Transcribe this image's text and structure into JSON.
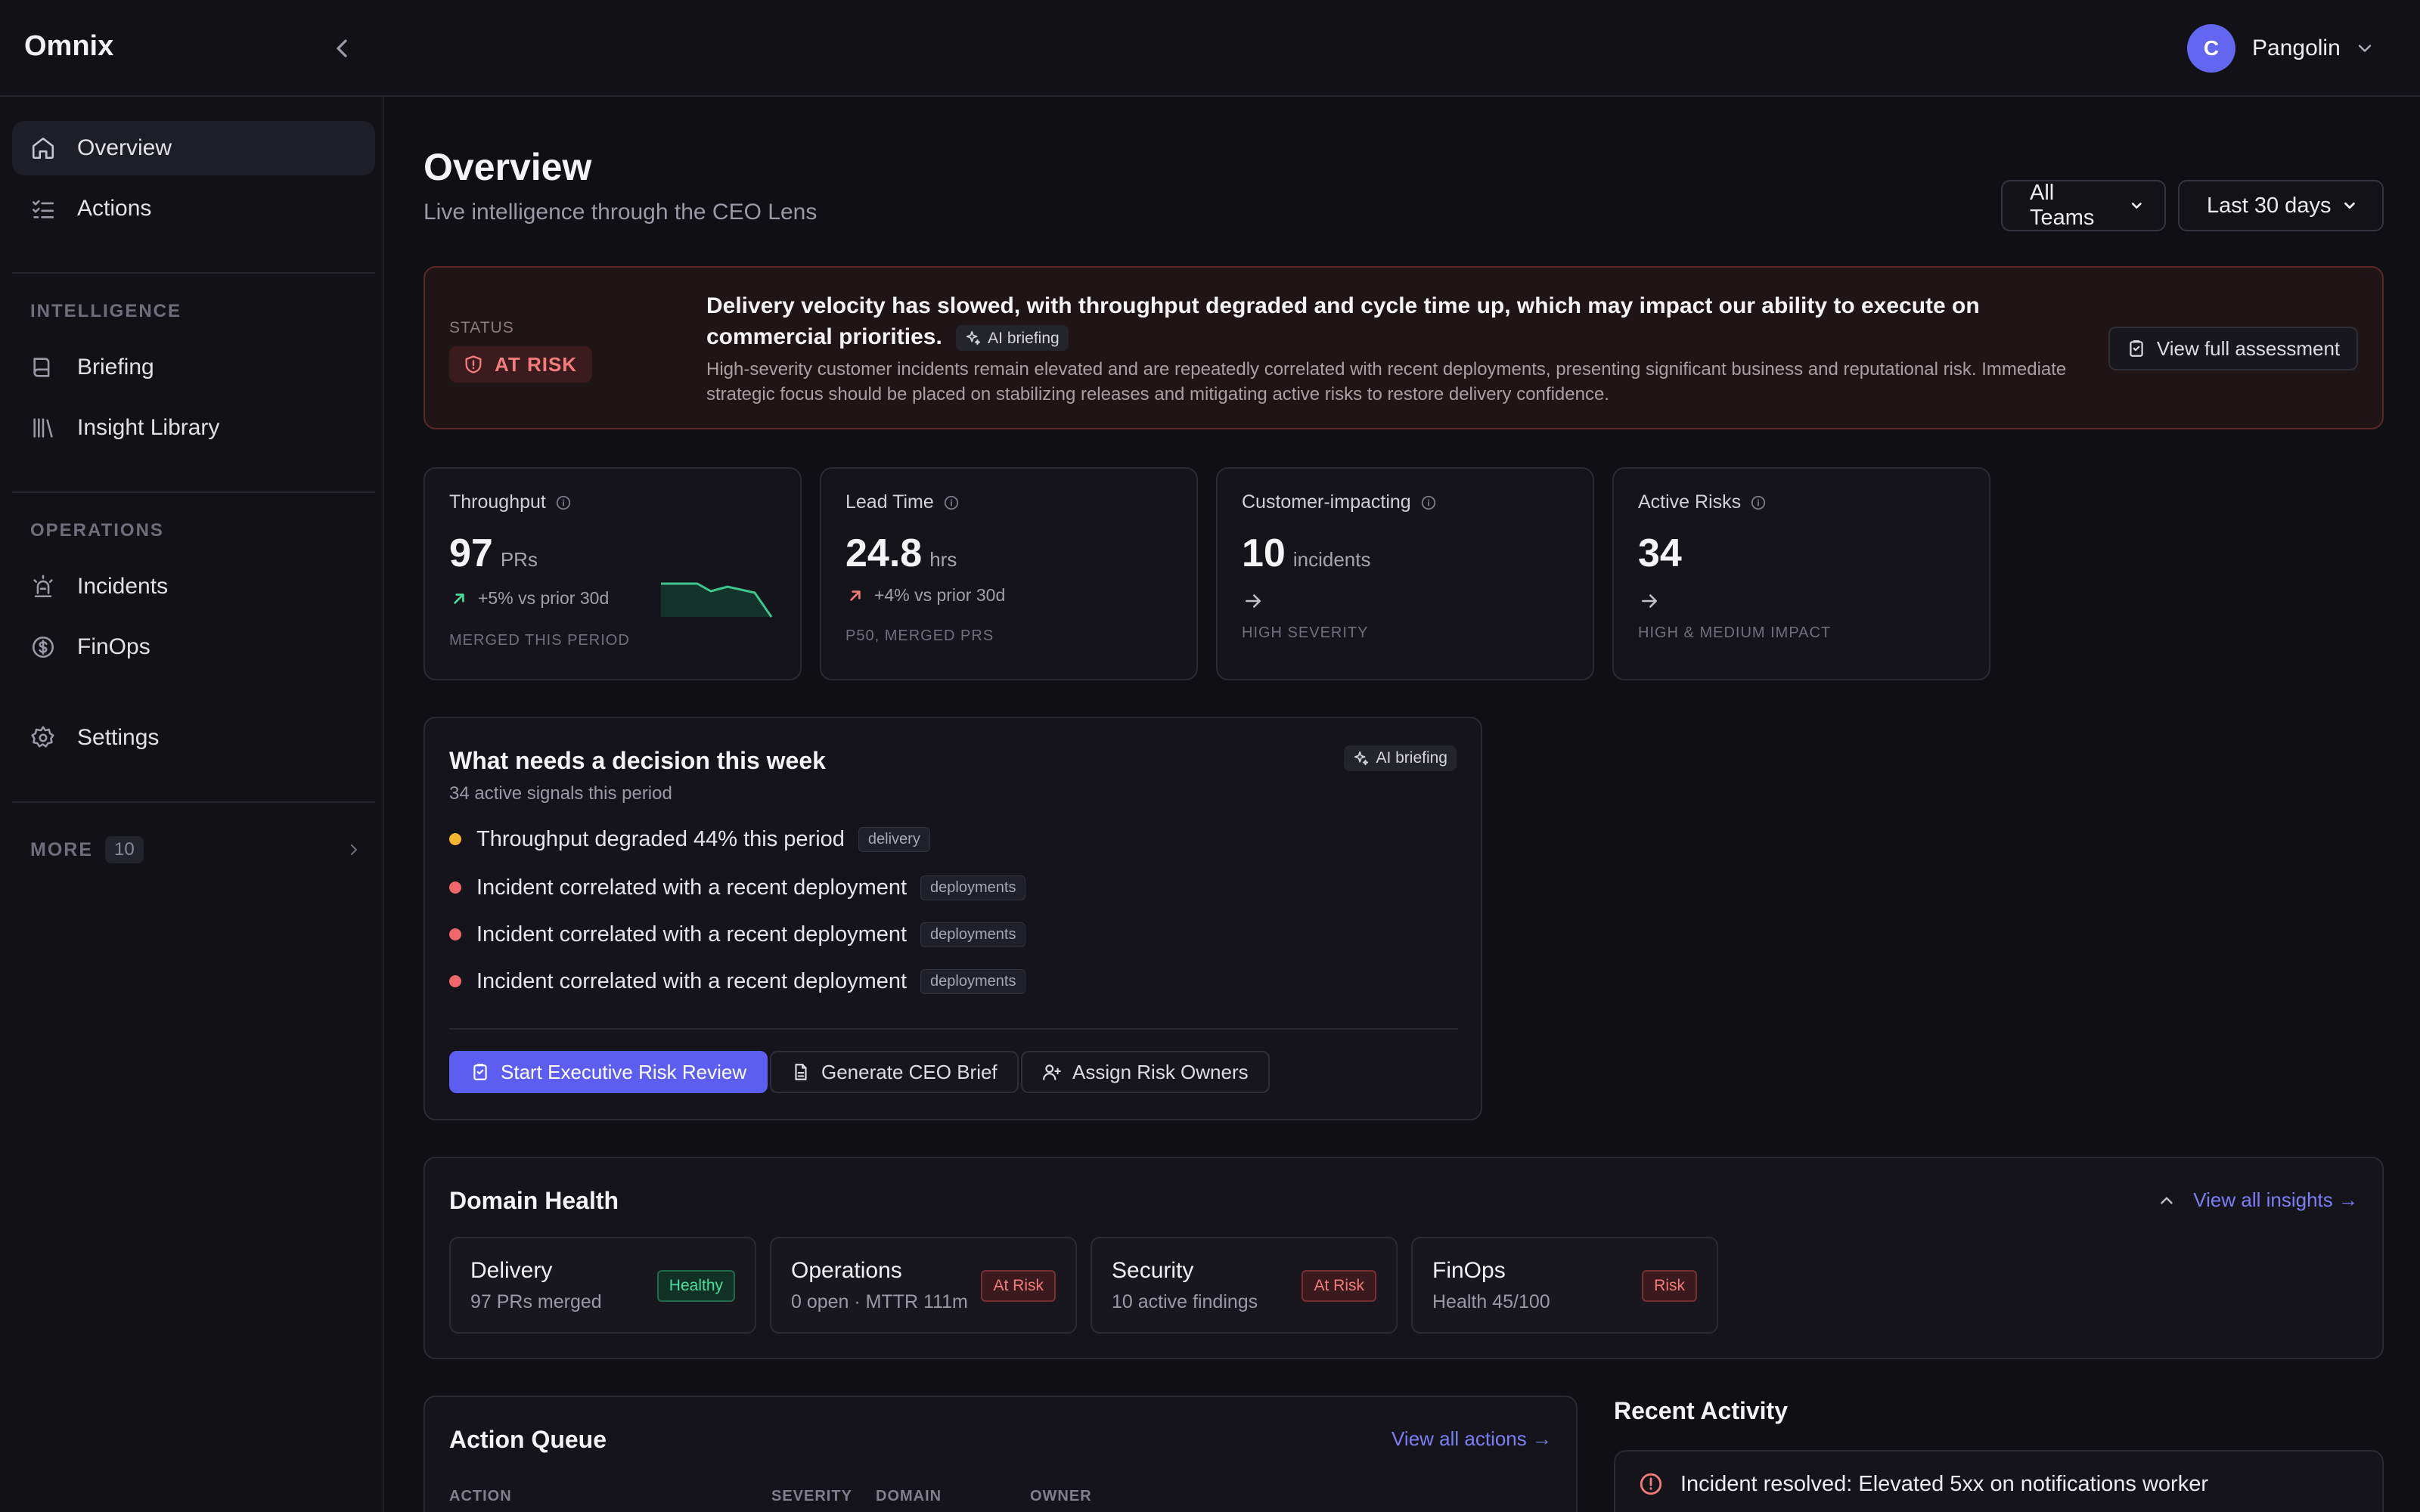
{
  "app": {
    "name": "Omnix"
  },
  "user": {
    "initial": "C",
    "name": "Pangolin"
  },
  "sidebar": {
    "items": [
      {
        "label": "Overview"
      },
      {
        "label": "Actions"
      },
      {
        "label": "Briefing"
      },
      {
        "label": "Insight Library"
      },
      {
        "label": "Incidents"
      },
      {
        "label": "FinOps"
      },
      {
        "label": "Settings"
      }
    ],
    "sections": {
      "intelligence": "INTELLIGENCE",
      "operations": "OPERATIONS"
    },
    "more": {
      "label": "MORE",
      "count": "10"
    }
  },
  "header": {
    "title": "Overview",
    "subtitle": "Live intelligence through the CEO Lens",
    "team_filter": "All Teams",
    "period_filter": "Last 30 days"
  },
  "status": {
    "label": "STATUS",
    "badge": "AT RISK",
    "headline": "Delivery velocity has slowed, with throughput degraded and cycle time up, which may impact our ability to execute on commercial priorities.",
    "ai_chip": "AI briefing",
    "body": "High-severity customer incidents remain elevated and are repeatedly correlated with recent deployments, presenting significant business and reputational risk. Immediate strategic focus should be placed on stabilizing releases and mitigating active risks to restore delivery confidence.",
    "button": "View full assessment",
    "color": "#f47b7b"
  },
  "kpis": [
    {
      "title": "Throughput",
      "value": "97",
      "unit": "PRs",
      "trend": "+5% vs prior 30d",
      "footer": "MERGED THIS PERIOD"
    },
    {
      "title": "Lead Time",
      "value": "24.8",
      "unit": "hrs",
      "trend": "+4% vs prior 30d",
      "footer": "P50, MERGED PRS"
    },
    {
      "title": "Customer-impacting",
      "value": "10",
      "unit": "incidents",
      "footer": "HIGH SEVERITY"
    },
    {
      "title": "Active Risks",
      "value": "34",
      "unit": "",
      "footer": "HIGH & MEDIUM IMPACT"
    }
  ],
  "decision": {
    "title": "What needs a decision this week",
    "subtitle": "34 active signals this period",
    "ai_chip": "AI briefing",
    "signals": [
      {
        "text": "Throughput degraded 44% this period",
        "tag": "delivery",
        "color": "#f5b52e"
      },
      {
        "text": "Incident correlated with a recent deployment",
        "tag": "deployments",
        "color": "#f0676a"
      },
      {
        "text": "Incident correlated with a recent deployment",
        "tag": "deployments",
        "color": "#f0676a"
      },
      {
        "text": "Incident correlated with a recent deployment",
        "tag": "deployments",
        "color": "#f0676a"
      }
    ],
    "buttons": {
      "primary": "Start Executive Risk Review",
      "brief": "Generate CEO Brief",
      "owners": "Assign Risk Owners"
    }
  },
  "domain_health": {
    "title": "Domain Health",
    "link": "View all insights →",
    "cards": [
      {
        "name": "Delivery",
        "sub": "97 PRs merged",
        "badge": "Healthy"
      },
      {
        "name": "Operations",
        "sub": "0 open · MTTR 111m",
        "badge": "At Risk"
      },
      {
        "name": "Security",
        "sub": "10 active findings",
        "badge": "At Risk"
      },
      {
        "name": "FinOps",
        "sub": "Health 45/100",
        "badge": "Risk"
      }
    ]
  },
  "action_queue": {
    "title": "Action Queue",
    "link": "View all actions →",
    "columns": [
      "ACTION",
      "SEVERITY",
      "DOMAIN",
      "OWNER"
    ]
  },
  "recent_activity": {
    "title": "Recent Activity",
    "items": [
      {
        "text": "Incident resolved: Elevated 5xx on notifications worker"
      }
    ]
  },
  "colors": {
    "accent": "#5b5ef0",
    "healthy": "#4ade9a",
    "risk": "#f27c7c"
  }
}
